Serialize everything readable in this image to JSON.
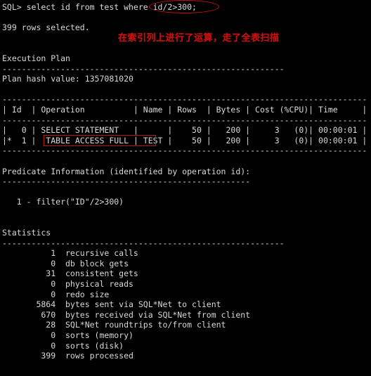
{
  "terminal": {
    "title": "SQL*Plus session",
    "background_color": "#000000",
    "foreground_color": "#d9d9d9",
    "annotation_color": "#c41111",
    "lines": [
      "SQL> select id from test where id/2>300;",
      "",
      "399 rows selected.",
      "",
      "",
      "Execution Plan",
      "----------------------------------------------------------",
      "Plan hash value: 1357081020",
      "",
      "---------------------------------------------------------------------------",
      "| Id  | Operation          | Name | Rows  | Bytes | Cost (%CPU)| Time     |",
      "---------------------------------------------------------------------------",
      "|   0 | SELECT STATEMENT   |      |    50 |   200 |     3   (0)| 00:00:01 |",
      "|*  1 |  TABLE ACCESS FULL | TEST |    50 |   200 |     3   (0)| 00:00:01 |",
      "---------------------------------------------------------------------------",
      "",
      "Predicate Information (identified by operation id):",
      "---------------------------------------------------",
      "",
      "   1 - filter(\"ID\"/2>300)",
      "",
      "",
      "Statistics",
      "----------------------------------------------------------",
      "          1  recursive calls",
      "          0  db block gets",
      "         31  consistent gets",
      "          0  physical reads",
      "          0  redo size",
      "       5864  bytes sent via SQL*Net to client",
      "        670  bytes received via SQL*Net from client",
      "         28  SQL*Net roundtrips to/from client",
      "          0  sorts (memory)",
      "          0  sorts (disk)",
      "        399  rows processed"
    ]
  },
  "sql": {
    "prompt": "SQL>",
    "statement": "select id from test where id/2>300;",
    "highlighted_expression": "id/2>300;"
  },
  "result": {
    "rows_selected_text": "399 rows selected.",
    "rows_selected_count": "399"
  },
  "annotations": {
    "note_text": "在索引列上进行了运算，走了全表扫描",
    "ellipse_target": "id/2>300;",
    "rect_target": "TABLE ACCESS FULL| TEST"
  },
  "execution_plan": {
    "heading": "Execution Plan",
    "separator": "----------------------------------------------------------",
    "plan_hash_label": "Plan hash value:",
    "plan_hash_value": "1357081020",
    "table_rule": "---------------------------------------------------------------------------",
    "columns": [
      "Id",
      "Operation",
      "Name",
      "Rows",
      "Bytes",
      "Cost (%CPU)",
      "Time"
    ],
    "rows": [
      {
        "mark": " ",
        "id": "0",
        "operation": "SELECT STATEMENT",
        "name": "",
        "rows": "50",
        "bytes": "200",
        "cost": "3   (0)",
        "time": "00:00:01"
      },
      {
        "mark": "*",
        "id": "1",
        "operation": " TABLE ACCESS FULL",
        "name": "TEST",
        "rows": "50",
        "bytes": "200",
        "cost": "3   (0)",
        "time": "00:00:01"
      }
    ]
  },
  "predicate_information": {
    "heading": "Predicate Information (identified by operation id):",
    "separator": "---------------------------------------------------",
    "entries": [
      "   1 - filter(\"ID\"/2>300)"
    ]
  },
  "statistics": {
    "heading": "Statistics",
    "separator": "----------------------------------------------------------",
    "items": [
      {
        "value": "1",
        "label": "recursive calls"
      },
      {
        "value": "0",
        "label": "db block gets"
      },
      {
        "value": "31",
        "label": "consistent gets"
      },
      {
        "value": "0",
        "label": "physical reads"
      },
      {
        "value": "0",
        "label": "redo size"
      },
      {
        "value": "5864",
        "label": "bytes sent via SQL*Net to client"
      },
      {
        "value": "670",
        "label": "bytes received via SQL*Net from client"
      },
      {
        "value": "28",
        "label": "SQL*Net roundtrips to/from client"
      },
      {
        "value": "0",
        "label": "sorts (memory)"
      },
      {
        "value": "0",
        "label": "sorts (disk)"
      },
      {
        "value": "399",
        "label": "rows processed"
      }
    ]
  }
}
